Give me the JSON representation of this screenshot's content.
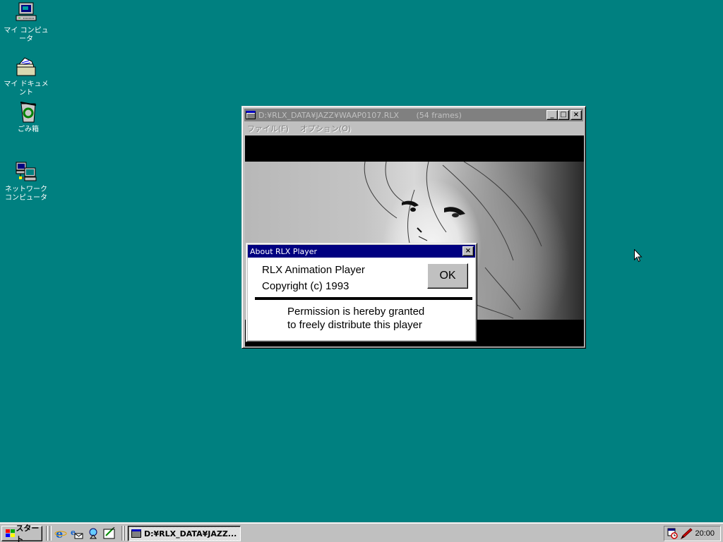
{
  "desktop": {
    "background_color": "#008080",
    "icons": [
      {
        "label": "マイ コンピュータ",
        "icon": "my-computer-icon"
      },
      {
        "label": "マイ ドキュメント",
        "icon": "my-documents-icon"
      },
      {
        "label": "ごみ箱",
        "icon": "recycle-bin-icon"
      },
      {
        "label": "ネットワーク\nコンピュータ",
        "icon": "network-neighborhood-icon"
      }
    ]
  },
  "player_window": {
    "title": "D:¥RLX_DATA¥JAZZ¥WAAP0107.RLX",
    "frames_info": "(54 frames)",
    "active": false,
    "menu": [
      "ファイル(F)",
      "オプション(O)"
    ],
    "buttons": {
      "minimize": "_",
      "maximize": "□",
      "close": "×"
    }
  },
  "about_dialog": {
    "title": "About RLX Player",
    "product_name": "RLX Animation Player",
    "copyright": "Copyright (c) 1993",
    "permission_line1": "Permission is hereby granted",
    "permission_line2": "to freely distribute this player",
    "ok_label": "OK",
    "close_label": "×"
  },
  "taskbar": {
    "start_label": "スタート",
    "quick_launch": [
      "internet-explorer-icon",
      "outlook-express-icon",
      "channels-icon",
      "show-desktop-icon"
    ],
    "tasks": [
      {
        "label": "D:¥RLX_DATA¥JAZZ...",
        "active": true
      }
    ],
    "tray_icons": [
      "scheduler-icon",
      "ime-pen-icon"
    ],
    "clock": "20:00"
  }
}
